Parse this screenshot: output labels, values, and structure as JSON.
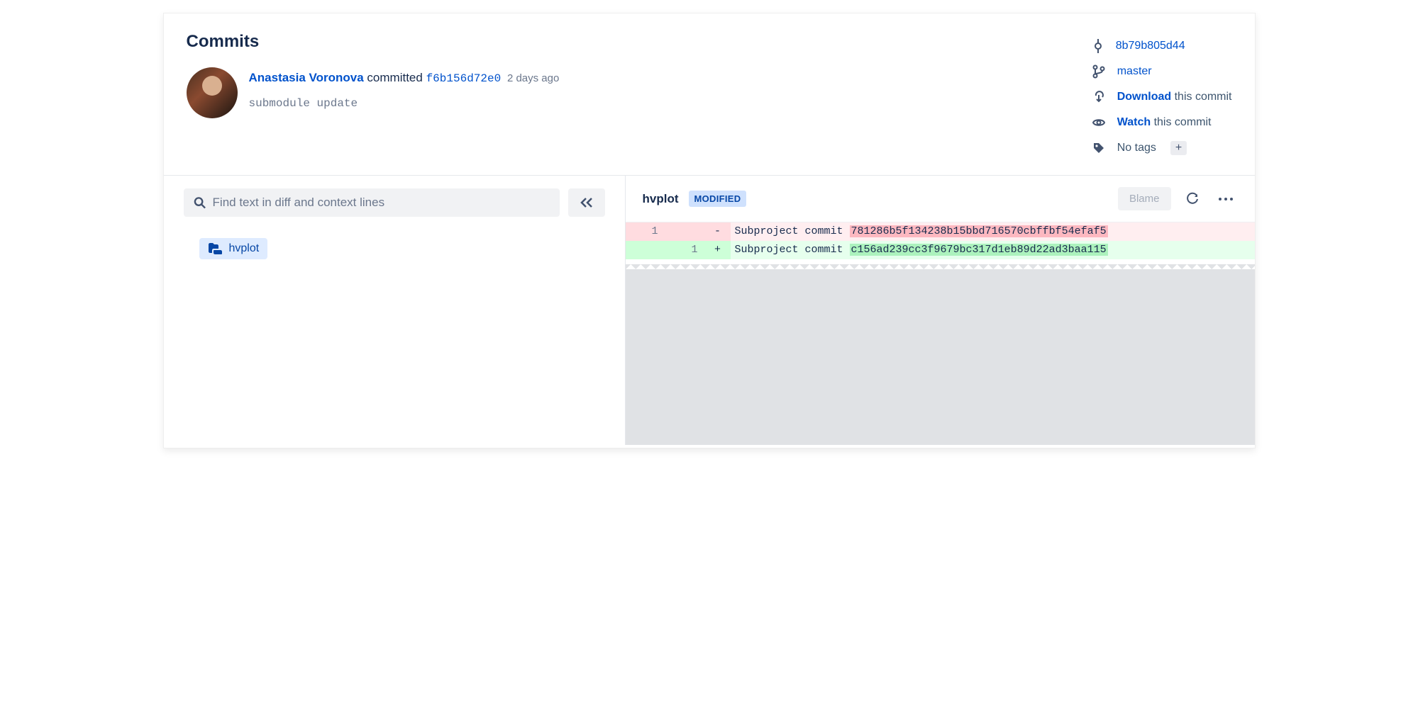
{
  "page_title": "Commits",
  "commit": {
    "author": "Anastasia Voronova",
    "committed_word": "committed",
    "short_hash": "f6b156d72e0",
    "relative_time": "2 days ago",
    "message": "submodule update"
  },
  "side": {
    "parent_hash": "8b79b805d44",
    "branch": "master",
    "download_bold": "Download",
    "download_rest": " this commit",
    "watch_bold": "Watch",
    "watch_rest": " this commit",
    "no_tags": "No tags",
    "add_tag": "+"
  },
  "search": {
    "placeholder": "Find text in diff and context lines"
  },
  "file_tree": {
    "selected": "hvplot"
  },
  "diff": {
    "filename": "hvplot",
    "badge": "MODIFIED",
    "blame": "Blame",
    "removed": {
      "old_ln": "1",
      "new_ln": "",
      "sign": "-",
      "prefix": "Subproject commit ",
      "hash": "781286b5f134238b15bbd716570cbffbf54efaf5"
    },
    "added": {
      "old_ln": "",
      "new_ln": "1",
      "sign": "+",
      "prefix": "Subproject commit ",
      "hash": "c156ad239cc3f9679bc317d1eb89d22ad3baa115"
    }
  }
}
